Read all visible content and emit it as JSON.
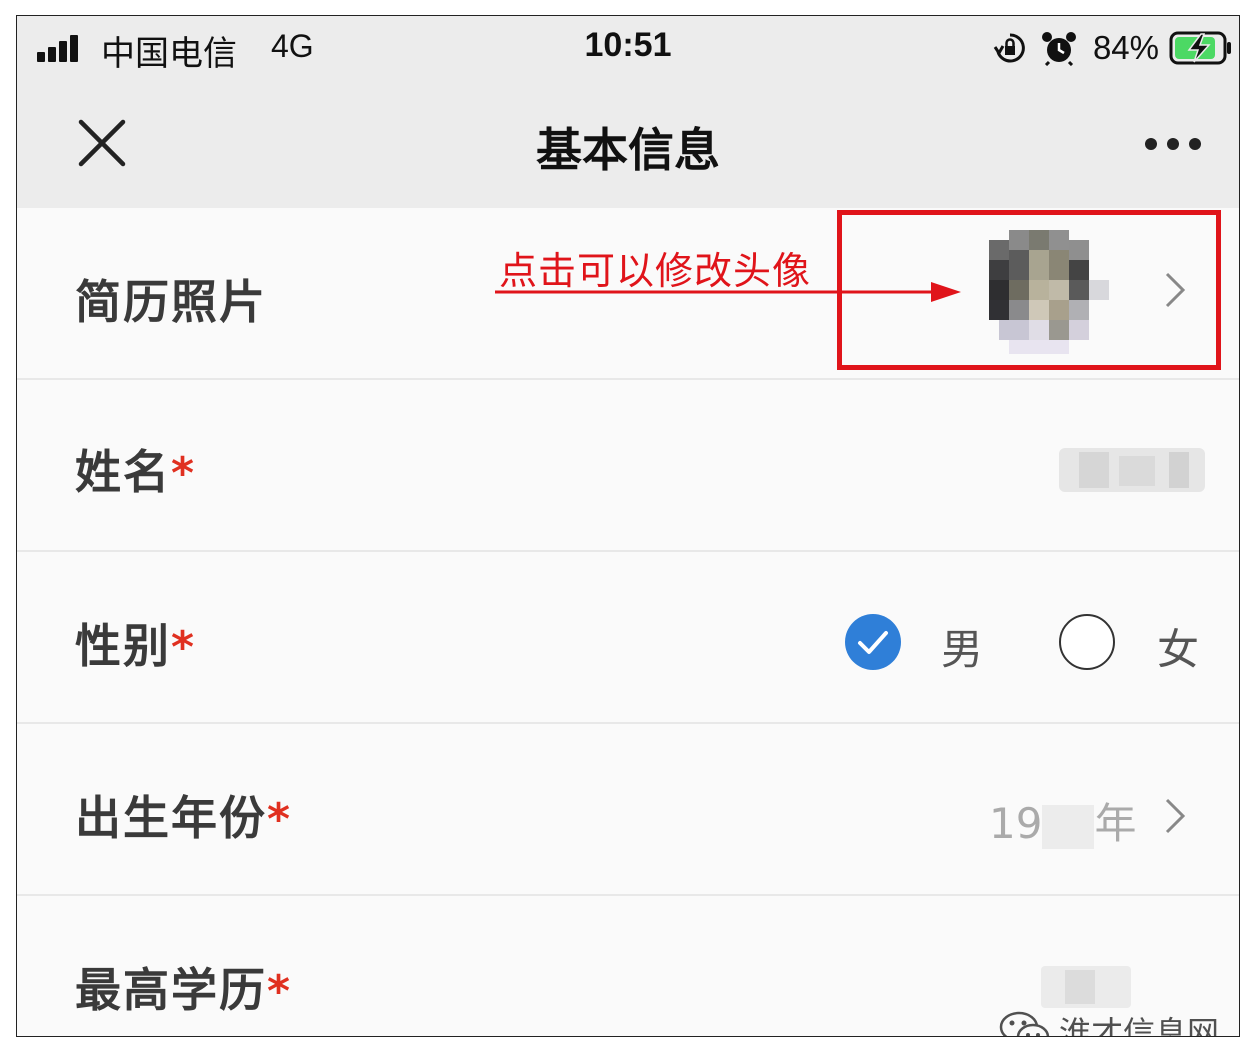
{
  "status": {
    "carrier": "中国电信",
    "network": "4G",
    "time": "10:51",
    "battery": "84%",
    "icons": [
      "signal-icon",
      "orientation-lock-icon",
      "alarm-icon",
      "battery-charging-icon"
    ]
  },
  "nav": {
    "title": "基本信息",
    "close_icon": "close-icon",
    "more_icon": "more-icon"
  },
  "rows": {
    "photo": {
      "label": "简历照片",
      "annotation": "点击可以修改头像"
    },
    "name": {
      "label": "姓名",
      "required": "*"
    },
    "gender": {
      "label": "性别",
      "required": "*",
      "options": [
        "男",
        "女"
      ],
      "selected": "男"
    },
    "birth_year": {
      "label": "出生年份",
      "required": "*",
      "value_prefix": "19",
      "value_suffix": "年"
    },
    "education": {
      "label": "最高学历",
      "required": "*"
    }
  },
  "watermark": "淮才信息网",
  "colors": {
    "accent_red": "#e0141a",
    "check_blue": "#2f7fd8",
    "required_red": "#e03020"
  }
}
